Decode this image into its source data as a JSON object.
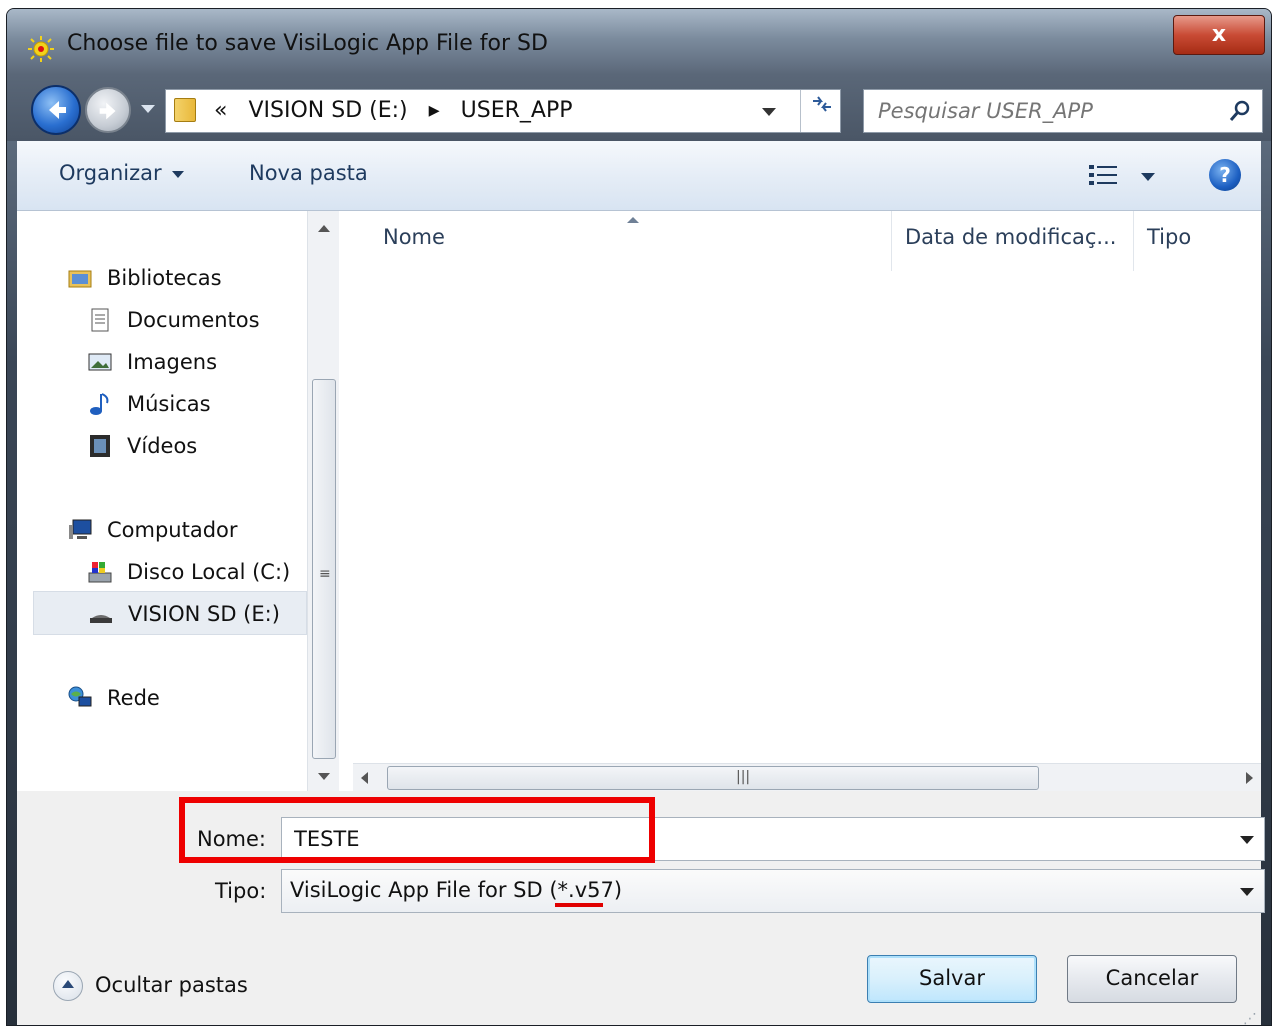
{
  "window": {
    "title": "Choose file to save VisiLogic App File for SD",
    "close_label": "x"
  },
  "address": {
    "overflow": "«",
    "crumbs": [
      "VISION SD (E:)",
      "▸",
      "USER_APP"
    ]
  },
  "search": {
    "placeholder": "Pesquisar USER_APP",
    "value": ""
  },
  "toolbar": {
    "organize_label": "Organizar",
    "new_folder_label": "Nova pasta",
    "help_label": "?"
  },
  "navpane": {
    "items": [
      {
        "label": "Bibliotecas",
        "icon": "libraries-icon"
      },
      {
        "label": "Documentos",
        "icon": "document-icon"
      },
      {
        "label": "Imagens",
        "icon": "image-icon"
      },
      {
        "label": "Músicas",
        "icon": "music-icon"
      },
      {
        "label": "Vídeos",
        "icon": "video-icon"
      },
      {
        "label": "Computador",
        "icon": "computer-icon"
      },
      {
        "label": "Disco Local (C:)",
        "icon": "local-disk-icon"
      },
      {
        "label": "VISION SD (E:)",
        "icon": "removable-drive-icon",
        "selected": true
      },
      {
        "label": "Rede",
        "icon": "network-icon"
      }
    ],
    "scroll_grip": "≡"
  },
  "filelist": {
    "columns": [
      "Nome",
      "Data de modificaç...",
      "Tipo"
    ],
    "rows": [],
    "hscroll_grip": "|||"
  },
  "form": {
    "name_label": "Nome:",
    "name_value": "TESTE",
    "type_label": "Tipo:",
    "type_value": "VisiLogic App File for SD (*.v57)"
  },
  "footer": {
    "hide_folders_label": "Ocultar pastas",
    "save_label": "Salvar",
    "cancel_label": "Cancelar"
  },
  "colors": {
    "highlight": "#ee0000",
    "accent": "#1c5fc2"
  }
}
